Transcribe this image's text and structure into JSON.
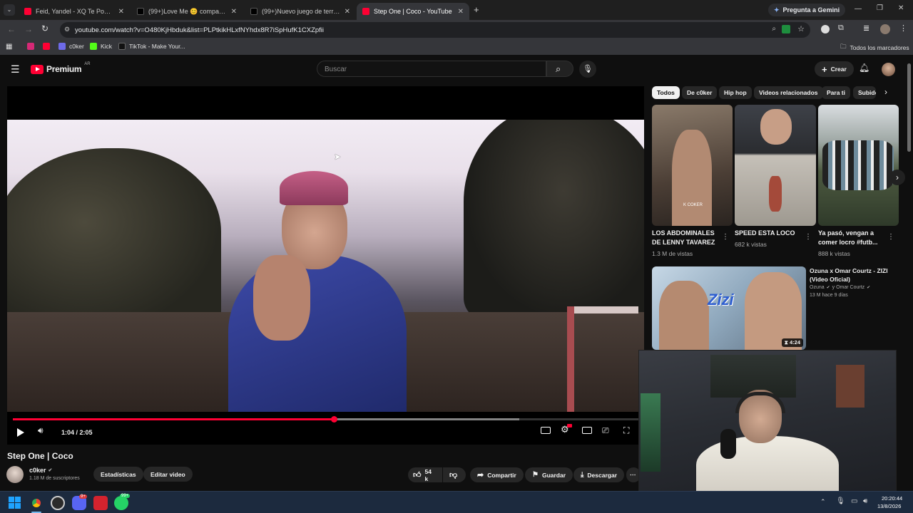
{
  "browser": {
    "tabs": [
      {
        "title": "Feid, Yandel - XQ Te Pones Así (",
        "favicon": "youtube-icon",
        "color": "#ff0033"
      },
      {
        "title": "(99+)Love Me 😊 compartan 💗",
        "favicon": "tiktok-icon",
        "color": "#111111"
      },
      {
        "title": "(99+)Nuevo juego de terror | U",
        "favicon": "tiktok-icon",
        "color": "#111111"
      },
      {
        "title": "Step One | Coco - YouTube",
        "favicon": "youtube-icon",
        "color": "#ff0033",
        "active": true
      }
    ],
    "new_tab": "+",
    "gemini_label": "Pregunta a Gemini",
    "url": "youtube.com/watch?v=O480KjHbduk&list=PLPtkikHLxfNYhdx8R7iSpHufK1CXZpfii",
    "bookmarks": [
      {
        "label": "",
        "icon": "instagram-icon",
        "color": "#d62976"
      },
      {
        "label": "",
        "icon": "youtube-icon",
        "color": "#ff0033"
      },
      {
        "label": "c0ker",
        "icon": "c0ker-icon",
        "color": "#6e6ae8"
      },
      {
        "label": "Kick",
        "icon": "kick-icon",
        "color": "#53fc18"
      },
      {
        "label": "TikTok - Make Your...",
        "icon": "tiktok-icon",
        "color": "#111111"
      }
    ],
    "all_bookmarks": "Todos los marcadores"
  },
  "youtube": {
    "logo_text": "Premium",
    "logo_region": "AR",
    "search_placeholder": "Buscar",
    "create_label": "Crear",
    "player": {
      "current_time": "1:04",
      "duration": "2:05",
      "time_display": "1:04 / 2:05",
      "progress": 0.513,
      "buffered": 0.81
    },
    "video_title": "Step One | Coco",
    "channel": {
      "name": "c0ker",
      "subscribers": "1.18 M de suscriptores"
    },
    "stats_button": "Estadísticas",
    "edit_button": "Editar video",
    "actions": {
      "likes": "54 k",
      "share": "Compartir",
      "save": "Guardar",
      "download": "Descargar"
    },
    "chips": [
      "Todos",
      "De c0ker",
      "Hip hop",
      "Videos relacionados",
      "Para ti",
      "Subidos"
    ],
    "shorts": [
      {
        "title": "LOS ABDOMINALES DE LENNY TAVAREZ",
        "views": "1.3 M de vistas"
      },
      {
        "title": "SPEED ESTA LOCO",
        "views": "682 k vistas"
      },
      {
        "title": "Ya pasó, vengan a comer locro  #futb...",
        "views": "888 k vistas"
      }
    ],
    "related": {
      "title": "Ozuna x Omar Courtz - ZIZI (Video Oficial)",
      "channel": "Ozuna",
      "channel2": "y Omar Courtz",
      "meta": "13 M  hace 9 días",
      "duration": "4:24",
      "thumb_text": "Zizi"
    }
  },
  "shorts_thumb_label": "K COKER",
  "taskbar": {
    "badge_discord": "9+",
    "badge_whatsapp": "99+",
    "time": "20:20:44",
    "date": "13/8/2026"
  }
}
